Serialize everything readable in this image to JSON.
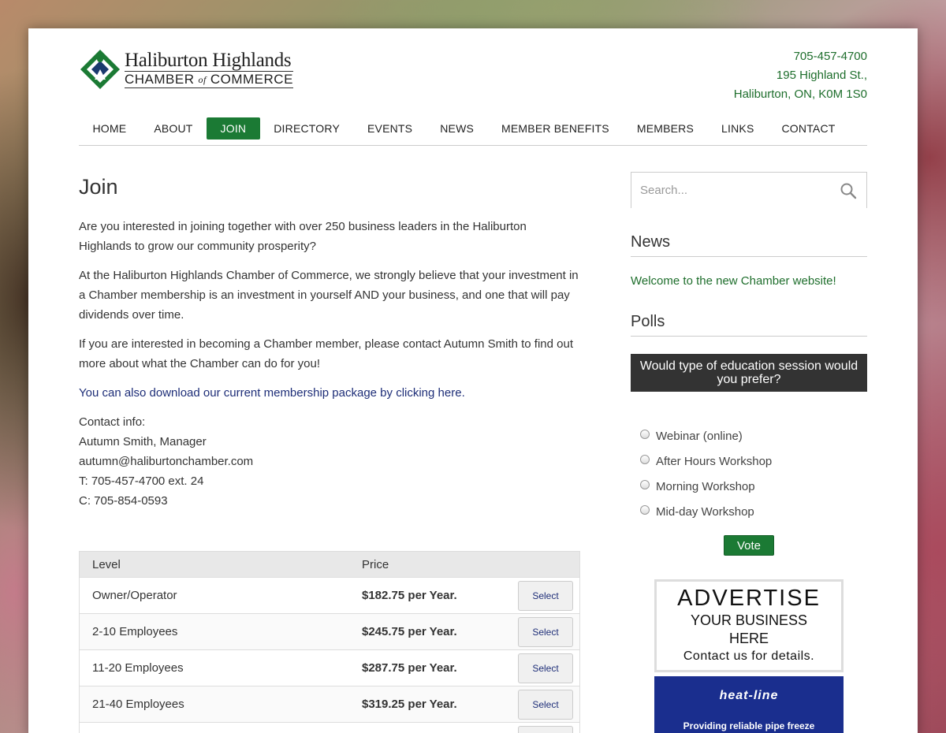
{
  "header": {
    "logo_line1": "Haliburton Highlands",
    "logo_chamber": "CHAMBER",
    "logo_of": "of",
    "logo_commerce": "COMMERCE",
    "phone": "705-457-4700",
    "address1": "195 Highland St.,",
    "address2": "Haliburton, ON, K0M 1S0"
  },
  "nav": [
    {
      "label": "HOME"
    },
    {
      "label": "ABOUT"
    },
    {
      "label": "JOIN"
    },
    {
      "label": "DIRECTORY"
    },
    {
      "label": "EVENTS"
    },
    {
      "label": "NEWS"
    },
    {
      "label": "MEMBER BENEFITS"
    },
    {
      "label": "MEMBERS"
    },
    {
      "label": "LINKS"
    },
    {
      "label": "CONTACT"
    }
  ],
  "main": {
    "title": "Join",
    "p1": "Are you interested in joining together with over 250 business leaders in the Haliburton Highlands to grow our community prosperity?",
    "p2": "At the Haliburton Highlands Chamber of Commerce, we strongly believe that your investment in a Chamber membership is an investment in yourself AND your business, and one that will pay dividends over time.",
    "p3": "If you are interested in becoming a Chamber member, please contact Autumn Smith to find out more about what the Chamber can do for you!",
    "p4_prefix": "You can also download our current membership package by ",
    "p4_link": "clicking here",
    "p4_suffix": ".",
    "contact_label": "Contact info:",
    "contact_name": "Autumn Smith, Manager",
    "contact_email": "autumn@haliburtonchamber.com",
    "contact_tel": "T: 705-457-4700 ext. 24",
    "contact_cell": "C: 705-854-0593"
  },
  "table": {
    "col_level": "Level",
    "col_price": "Price",
    "rows": [
      {
        "level": "Owner/Operator",
        "price": "$182.75",
        "suffix": " per Year.",
        "button": "Select"
      },
      {
        "level": "2-10 Employees",
        "price": "$245.75",
        "suffix": " per Year.",
        "button": "Select"
      },
      {
        "level": "11-20 Employees",
        "price": "$287.75",
        "suffix": " per Year.",
        "button": "Select"
      },
      {
        "level": "21-40 Employees",
        "price": "$319.25",
        "suffix": " per Year.",
        "button": "Select"
      }
    ]
  },
  "sidebar": {
    "search_placeholder": "Search...",
    "news_heading": "News",
    "news_link": "Welcome to the new Chamber website!",
    "polls_heading": "Polls",
    "poll_question": "Would type of education session would you prefer?",
    "poll_options": [
      {
        "label": "Webinar (online)"
      },
      {
        "label": "After Hours Workshop"
      },
      {
        "label": "Morning Workshop"
      },
      {
        "label": "Mid-day Workshop"
      }
    ],
    "vote_label": "Vote"
  },
  "ads": {
    "ad1_line1": "ADVERTISE",
    "ad1_line2": "YOUR BUSINESS",
    "ad1_line3": "HERE",
    "ad1_line4": "Contact us for details.",
    "ad2_brand": "heat-line",
    "ad2_tag": "Providing reliable pipe freeze"
  },
  "colors": {
    "brand_green": "#1b7a34",
    "link_blue": "#1e2e78",
    "ad_blue": "#1a2e8e"
  }
}
